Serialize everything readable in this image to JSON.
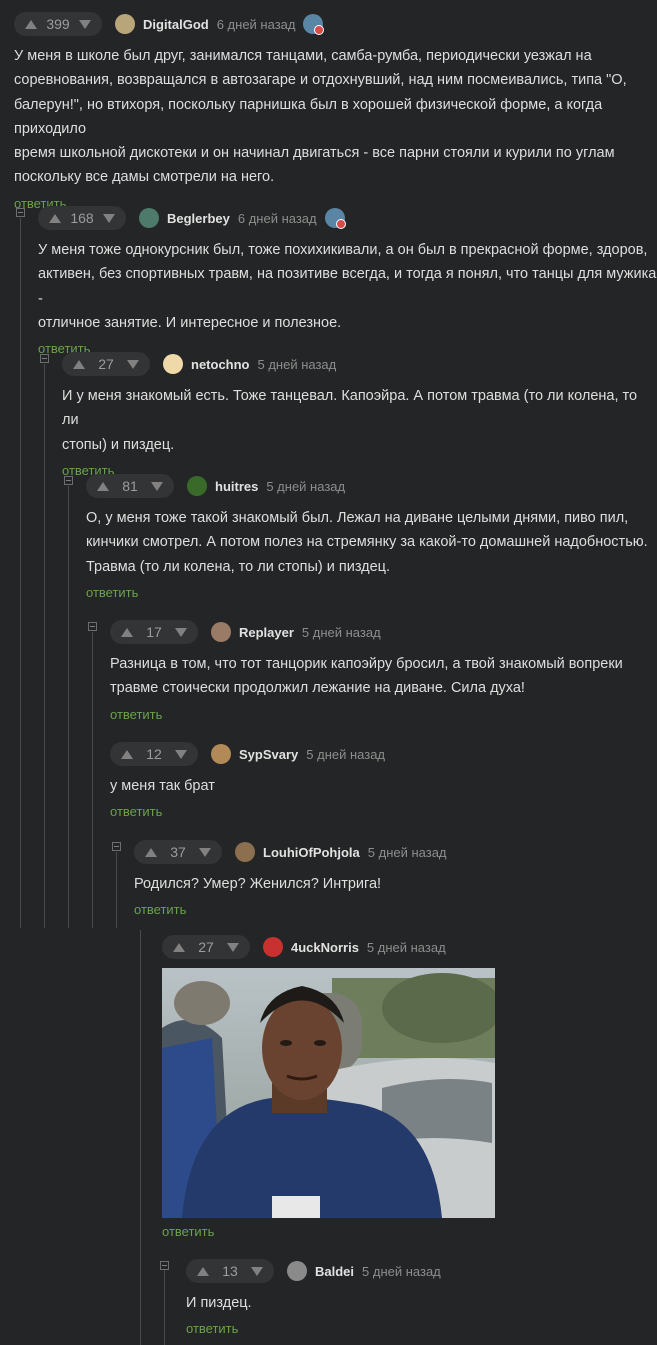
{
  "comments": [
    {
      "score": "399",
      "author": "DigitalGod",
      "time": "6 дней назад",
      "text": "У меня в школе был друг, занимался танцами, самба-румба, периодически уезжал на\nсоревнования, возвращался в автозагаре и отдохнувший, над ним посмеивались, типа \"О,\nбалерун!\", но втихоря, поскольку парнишка был в хорошей физической форме, а когда приходило\nвремя школьной дискотеки и он начинал двигаться - все парни стояли и курили по углам\nпоскольку все дамы смотрели на него.",
      "reply": "ответить",
      "avatar_color": "#b9a57a"
    },
    {
      "score": "168",
      "author": "Beglerbey",
      "time": "6 дней назад",
      "text": "У меня тоже однокурсник был, тоже похихикивали, а он был в прекрасной форме, здоров,\nактивен, без спортивных травм, на позитиве всегда, и тогда я понял, что танцы для мужика -\nотличное занятие. И интересное и полезное.",
      "reply": "ответить",
      "avatar_color": "#4d7a6a"
    },
    {
      "score": "27",
      "author": "netochno",
      "time": "5 дней назад",
      "text": "И у меня знакомый есть. Тоже танцевал. Капоэйра. А потом травма (то ли колена, то ли\nстопы) и пиздец.",
      "reply": "ответить",
      "avatar_color": "#f0d9a8"
    },
    {
      "score": "81",
      "author": "huitres",
      "time": "5 дней назад",
      "text": "О, у меня тоже такой знакомый был. Лежал на диване целыми днями, пиво пил,\nкинчики смотрел. А потом полез на стремянку за какой-то домашней надобностью.\nТравма (то ли колена, то ли стопы) и пиздец.",
      "reply": "ответить",
      "avatar_color": "#3a6a2a"
    },
    {
      "score": "17",
      "author": "Replayer",
      "time": "5 дней назад",
      "text": "Разница в том, что тот танцорик капоэйру бросил, а твой знакомый вопреки\nтравме стоически продолжил лежание на диване. Сила духа!",
      "reply": "ответить",
      "avatar_color": "#9a7b65"
    },
    {
      "score": "12",
      "author": "SypSvary",
      "time": "5 дней назад",
      "text": "у меня так брат",
      "reply": "ответить",
      "avatar_color": "#b28a58"
    },
    {
      "score": "37",
      "author": "LouhiOfPohjola",
      "time": "5 дней назад",
      "text": "Родился? Умер? Женился? Интрига!",
      "reply": "ответить",
      "avatar_color": "#8b6f4e"
    },
    {
      "score": "27",
      "author": "4uckNorris",
      "time": "5 дней назад",
      "text": "",
      "reply": "ответить",
      "avatar_color": "#c8312f"
    },
    {
      "score": "13",
      "author": "Baldei",
      "time": "5 дней назад",
      "text": "И пиздец.",
      "reply": "ответить",
      "avatar_color": "#8a8a8a"
    }
  ]
}
